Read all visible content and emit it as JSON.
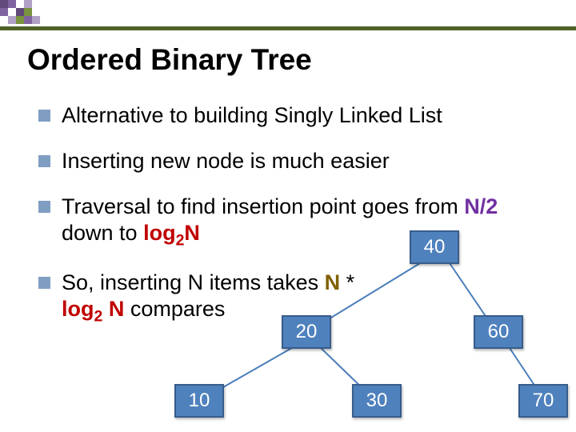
{
  "title": "Ordered Binary Tree",
  "bullets": {
    "b1": "Alternative to building Singly Linked List",
    "b2": "Inserting new node is much easier",
    "b3_a": "Traversal to find insertion point goes from ",
    "b3_n2": "N/2",
    "b3_b": " down to ",
    "b3_log": "log",
    "b3_sub": "2",
    "b3_N": "N",
    "b4_a": "So, inserting N items takes ",
    "b4_N": "N",
    "b4_b": " * ",
    "b4_log": "log",
    "b4_sub": "2",
    "b4_logN": " N",
    "b4_c": " compares"
  },
  "tree": {
    "n40": "40",
    "n20": "20",
    "n60": "60",
    "n10": "10",
    "n30": "30",
    "n70": "70"
  },
  "deco_colors": {
    "dark": "#604a7b",
    "mid": "#8064a2",
    "light": "#b1a1c7",
    "green": "#77933c",
    "bar": "#4f6228"
  }
}
